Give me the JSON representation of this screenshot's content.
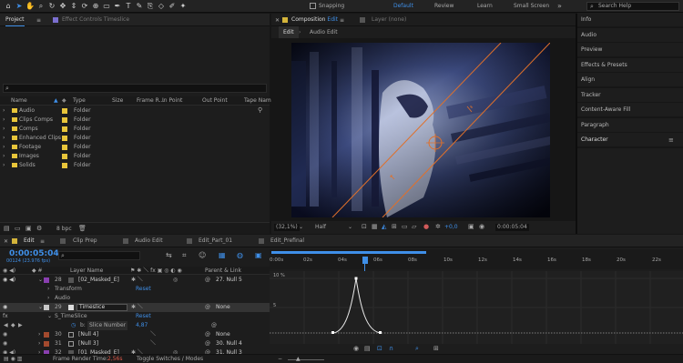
{
  "toolbar": {
    "snapping_label": "Snapping",
    "workspaces": [
      "Default",
      "Review",
      "Learn",
      "Small Screen"
    ],
    "search_placeholder": "Search Help"
  },
  "project_panel": {
    "tab": "Project",
    "effect_controls": "Effect Controls Timeslice",
    "search_icon": "search-icon",
    "columns": [
      "Name",
      "Type",
      "Size",
      "Frame R...",
      "In Point",
      "Out Point",
      "Tape Nam"
    ],
    "items": [
      {
        "name": "Audio",
        "type": "Folder"
      },
      {
        "name": "Clips Comps",
        "type": "Folder"
      },
      {
        "name": "Comps",
        "type": "Folder"
      },
      {
        "name": "Enhanced Clips",
        "type": "Folder"
      },
      {
        "name": "Footage",
        "type": "Folder"
      },
      {
        "name": "Images",
        "type": "Folder"
      },
      {
        "name": "Solids",
        "type": "Folder"
      }
    ],
    "bpc": "8 bpc"
  },
  "composition_panel": {
    "tab_prefix": "Composition",
    "tab_name": "Edit",
    "layer_tab": "Layer (none)",
    "subtabs": [
      "Edit",
      "Audio Edit"
    ],
    "zoom": "(32,1%)",
    "resolution": "Half",
    "exposure": "+0,0",
    "timecode": "0:00:05:04"
  },
  "sidebar": {
    "items": [
      "Info",
      "Audio",
      "Preview",
      "Effects & Presets",
      "Align",
      "Tracker",
      "Content-Aware Fill",
      "Paragraph",
      "Character"
    ]
  },
  "timeline": {
    "tabs": [
      "Edit",
      "Clip Prep",
      "Audio Edit",
      "Edit_Part_01",
      "Edit_Prefinal"
    ],
    "timecode": "0:00:05:04",
    "frame_info": "00124 (23.976 fps)",
    "search_placeholder": "",
    "col_layer_name": "Layer Name",
    "col_parent": "Parent & Link",
    "ruler": [
      "0:00s",
      "02s",
      "04s",
      "06s",
      "08s",
      "10s",
      "12s",
      "14s",
      "16s",
      "18s",
      "20s",
      "22s"
    ],
    "graph_label_top": "10 %",
    "graph_label_mid": "5",
    "layers": [
      {
        "num": "28",
        "name": "[02_Masked_E]",
        "color": "#8a3fb0",
        "parent": "27. Null 5"
      },
      {
        "sub": "Transform",
        "value": "Reset"
      },
      {
        "sub": "Audio",
        "value": ""
      },
      {
        "num": "29",
        "name": "Timeslice",
        "color": "#c8c8c8",
        "parent": "None"
      },
      {
        "sub": "S_TimeSlice",
        "value": "Reset"
      },
      {
        "sub": "Slice Number",
        "value": "4,87"
      },
      {
        "num": "30",
        "name": "[Null 4]",
        "color": "#a34a2e",
        "parent": "None"
      },
      {
        "num": "31",
        "name": "[Null 3]",
        "color": "#a34a2e",
        "parent": "30. Null 4"
      },
      {
        "num": "32",
        "name": "[01_Masked_E]",
        "color": "#8a3fb0",
        "parent": "31. Null 3"
      }
    ],
    "footer": {
      "render_label": "Frame Render Time:",
      "render_value": "2,56s",
      "toggle_label": "Toggle Switches / Modes"
    }
  },
  "colors": {
    "accent": "#3f8fe8",
    "guide": "#e0702a",
    "folder": "#e8c53a"
  }
}
